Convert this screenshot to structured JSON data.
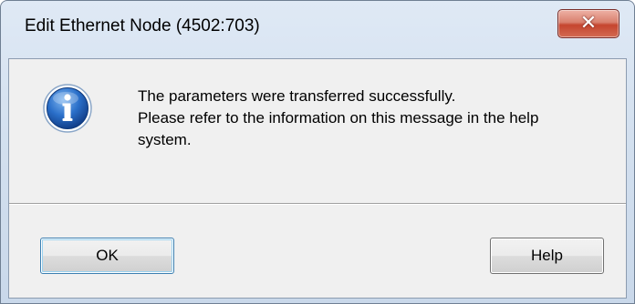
{
  "window": {
    "title": "Edit Ethernet Node (4502:703)",
    "close_icon": "close-icon",
    "close_glyph": "✕"
  },
  "dialog": {
    "icon": "info-icon",
    "message_lines": [
      "The parameters were transferred successfully.",
      "Please refer to the information on this message in the help",
      "system."
    ]
  },
  "buttons": {
    "ok_label": "OK",
    "help_label": "Help"
  },
  "colors": {
    "titlebar": "#d3e0ef",
    "close_button": "#c5452f",
    "dialog_background": "#f0f0f0",
    "info_icon": "#1c5fb5"
  }
}
